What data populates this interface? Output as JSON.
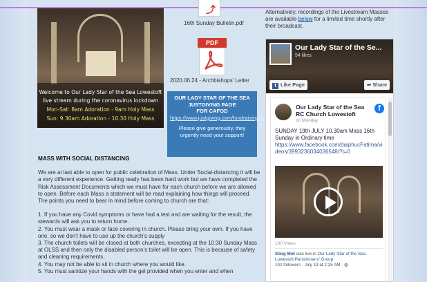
{
  "page": {
    "top_bulletin_caption": "16th Sunday Bulletin.pdf",
    "pdf_label": "PDF",
    "letter_caption": "2020.06.24 - Archbishops' Letter",
    "photo_captions": [
      "Welcome to Our Lady Star of the Sea Lowestoft",
      "live stream during the coronavirus lockdown",
      "Mon-Sat: 8am Adoration - 9am Holy Mass",
      "Sun: 9.30am Adoration - 10.30 Holy Mass"
    ],
    "justgiving": {
      "line1": "OUR LADY STAR OF THE SEA",
      "line2": "JUSTGIVING PAGE",
      "line3": "FOR CAFOD",
      "url": "https://www.justgiving.com/fundraising/gagalong",
      "appeal": "Please give generously, they urgently need your support!"
    },
    "right_intro": {
      "before": "Alternatively, recordings of the Livestream Masses are available ",
      "link": "below",
      "after": " for a limited time shortly after their broadcast."
    },
    "article": {
      "heading": "MASS WITH SOCIAL DISTANCING",
      "paragraph": "We are at last able to open for public celebration of Mass. Under Social-distancing it will be a very different experience. Getting ready has been hard work but we have completed the Risk Assessment Documents which we must have for each church before we are allowed to open. Before each Mass a statement will be read explaining how things will proceed. The points you need to bear in mind before coming to church are that:",
      "points": [
        "1. If you have any Covid symptoms or have had a test and are waiting for the result, the stewards will ask you to return home.",
        "2. You must wear a mask or face covering in church. Please bring your own. If you have one, so we don't have to use up the church's supply",
        "3. The church toilets will be closed at both churches, excepting at the 10:30 Sunday Mass at OLSS and then only the disabled person's toilet will be open. This is because of safety and cleaning requirements.",
        "4. You may not be able to sit in church where you would like.",
        "5. You must sanitize your hands with the gel provided when you enter and when"
      ]
    },
    "facebook": {
      "page_name": "Our Lady Star of the Se...",
      "likes": "54 likes",
      "like_button": "Like Page",
      "share_button": "Share",
      "post_author": "Our Lady Star of the Sea RC Church Lowestoft",
      "post_date": "on Monday",
      "post_text": "SUNDAY 19th JULY 10.30am Mass 16th Sunday in Ordinary time",
      "post_link": "https://www.facebook.com/daiphucFatima/videos/399323603403654​8/?t=0",
      "views": "100 Views",
      "shared_name": "Sống Mới",
      "shared_text": " was live in ",
      "shared_group": "Our Lady Star of the Sea Lowestoft Parishioners' Group",
      "shared_meta": "102 followers · July 19 at 2:25 AM · ",
      "fb_logo": "f"
    }
  },
  "colors": {
    "background": "#d6e3f1",
    "blue_box": "#3a7bb7",
    "pdf_red": "#d3392f",
    "facebook_blue": "#1877f2",
    "top_line": "#c07be0"
  },
  "icons": [
    "pdf-icon",
    "play-icon",
    "facebook-logo-icon",
    "share-icon"
  ]
}
